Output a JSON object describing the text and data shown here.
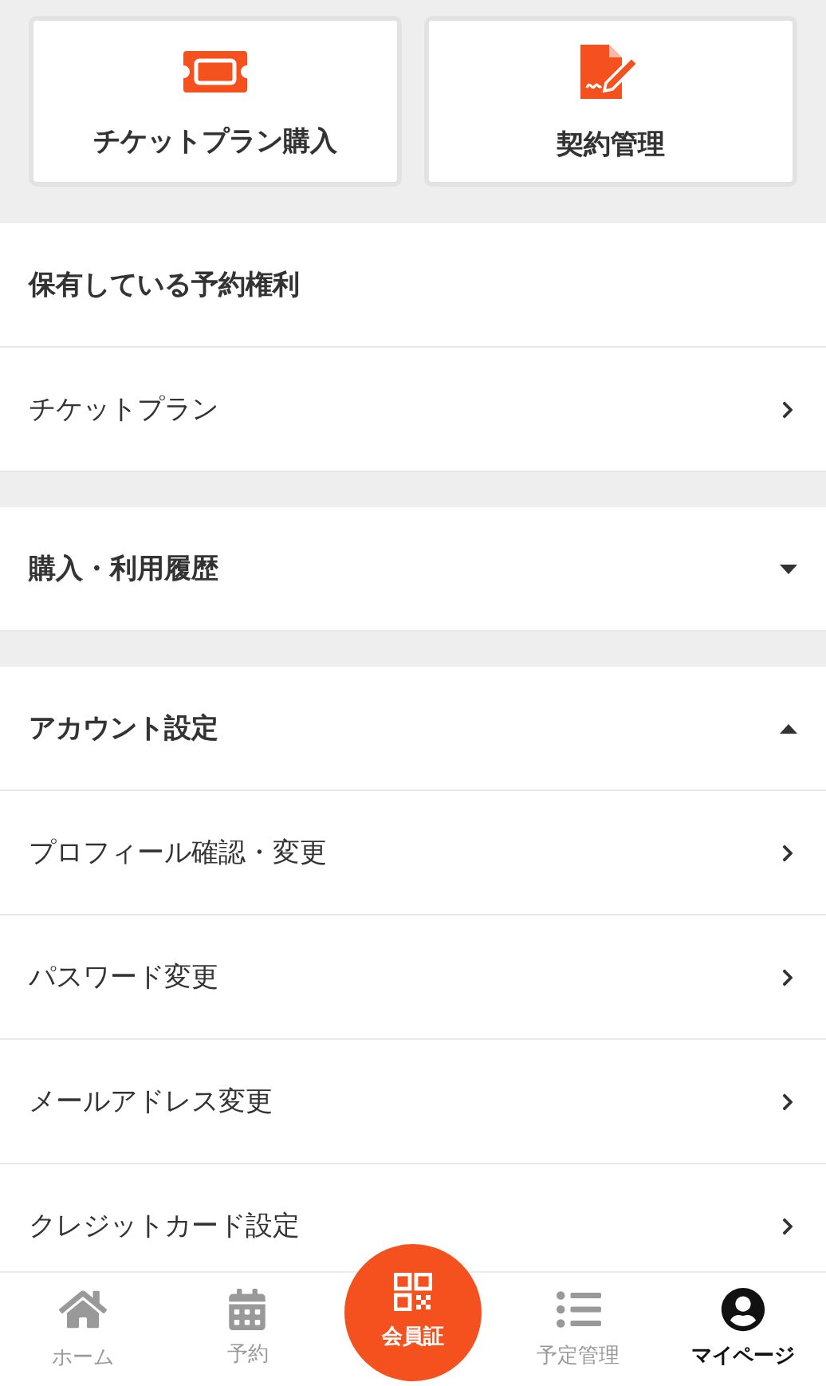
{
  "shortcuts": [
    {
      "kind": "ticket",
      "label": "チケットプラン購入"
    },
    {
      "kind": "contract",
      "label": "契約管理"
    }
  ],
  "sections": [
    {
      "title": "保有している予約権利",
      "items": [
        "チケットプラン"
      ]
    },
    {
      "title": "購入・利用履歴",
      "expanded": false
    },
    {
      "title": "アカウント設定",
      "expanded": true,
      "items": [
        "プロフィール確認・変更",
        "パスワード変更",
        "メールアドレス変更",
        "クレジットカード設定"
      ]
    }
  ],
  "nav": [
    {
      "kind": "home",
      "label": "ホーム",
      "selected": false
    },
    {
      "kind": "calendar",
      "label": "予約",
      "selected": false
    },
    {
      "kind": "card",
      "label": "会員証",
      "selected": false
    },
    {
      "kind": "list",
      "label": "予定管理",
      "selected": false
    },
    {
      "kind": "user",
      "label": "マイページ",
      "selected": true
    }
  ]
}
